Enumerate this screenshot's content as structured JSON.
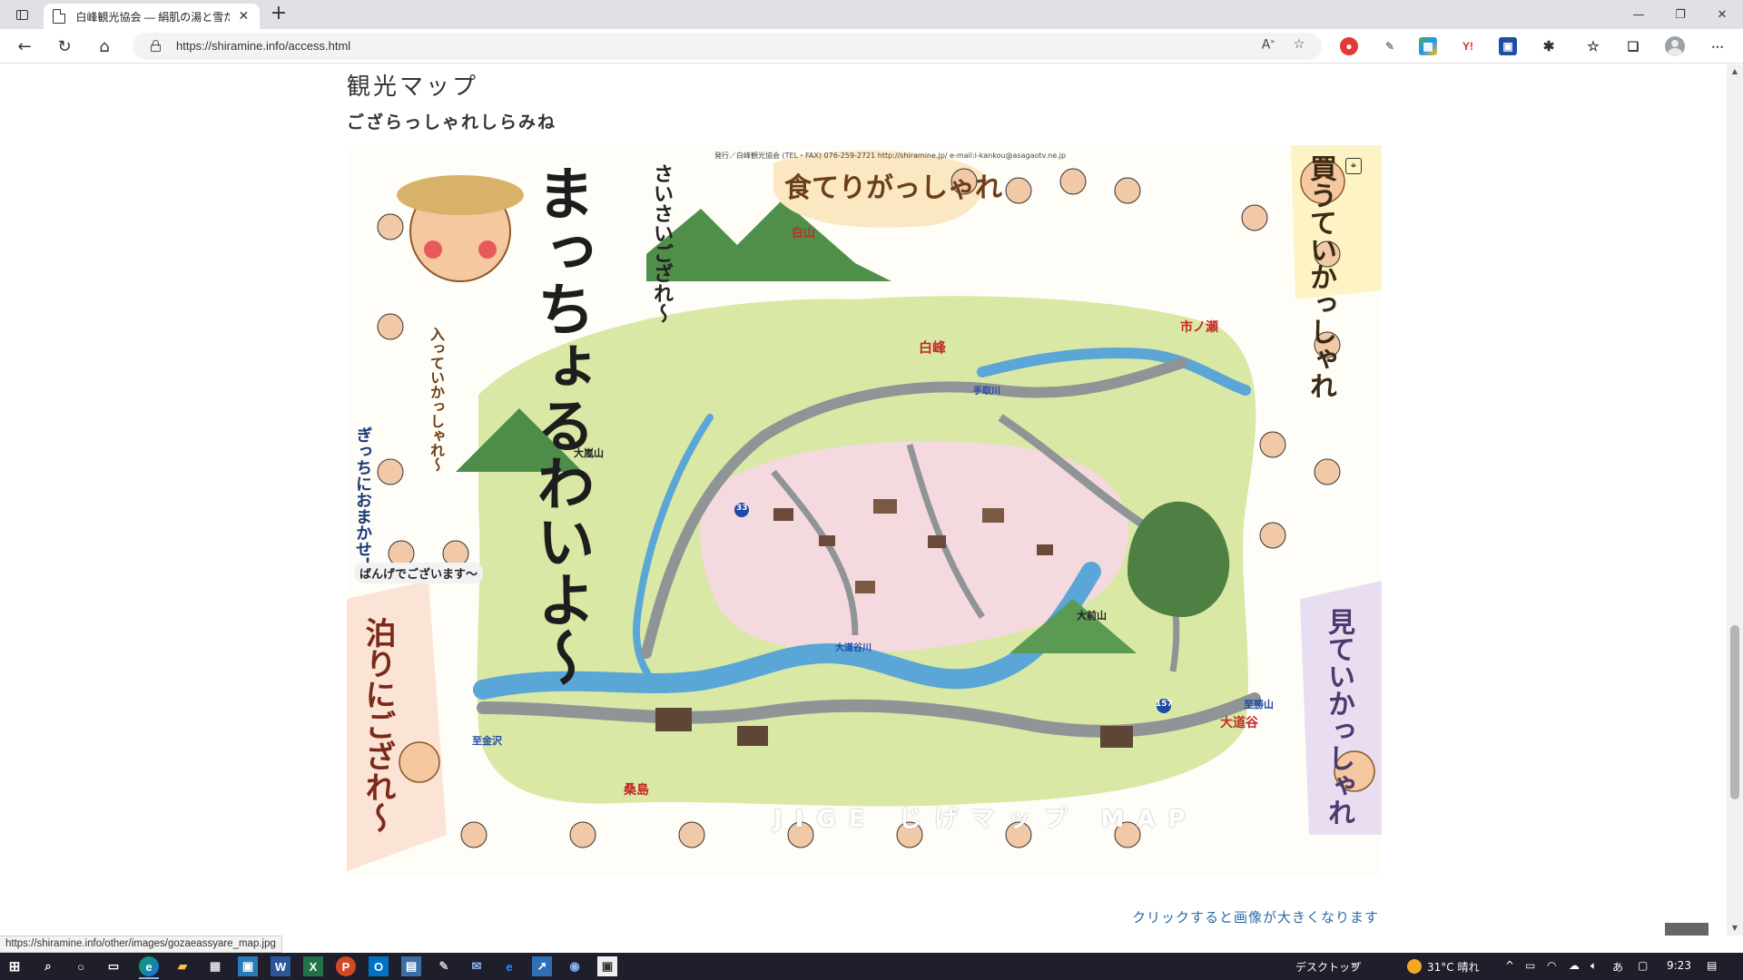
{
  "browser": {
    "tab_title": "白峰観光協会 — 絹肌の湯と雪だるまの里",
    "tab_close": "✕",
    "new_tab": "+",
    "url": "https://shiramine.info/access.html",
    "window": {
      "minimize": "—",
      "restore": "❐",
      "close": "✕"
    },
    "nav": {
      "back": "←",
      "reload": "↻",
      "home": "⌂"
    }
  },
  "page": {
    "title": "観光マップ",
    "subtitle": "ござらっしゃれしらみね",
    "image_caption_link": "クリックすると画像が大きくなります",
    "scroll_top": "↑"
  },
  "map": {
    "header_line": "発行／白峰観光協会 (TEL・FAX) 076-259-2721 http://shiramine.jp/ e-mail:i-kankou@asagaotv.ne.jp",
    "slogans": {
      "main": "まっちょるわいよ〜",
      "eat": "食てりがっしゃれ",
      "buy": "買うていかっしゃれ",
      "see": "見ていかっしゃれ",
      "stay": "泊りにござれ〜",
      "welcome": "さいさいござれ〜",
      "bath": "入っていかっしゃれ〜",
      "guide": "ぎっちにおまかせ！",
      "banner": "ばんげでございます〜",
      "bottom_title": "JIGE じげマップ MAP"
    },
    "places": {
      "hakusan": "白山",
      "shiramine": "白峰",
      "ichinose": "市ノ瀬",
      "oomichidani": "大道谷",
      "kuwajima": "桑島",
      "oarashiyama": "大嵐山",
      "ookanayama": "大前山",
      "shishiumi": "至金沢",
      "shishiganami": "至勝山",
      "tedorigawa": "手取川",
      "daidoyagawa": "大道谷川",
      "route33": "33",
      "route157": "157"
    }
  },
  "statusbar": {
    "hover_url": "https://shiramine.info/other/images/gozaeassyare_map.jpg"
  },
  "taskbar": {
    "desktop_label": "デスクトップ",
    "weather": "31°C 晴れ",
    "ime": "あ",
    "time": "9:23"
  },
  "colors": {
    "link": "#2a6aa5",
    "scroll_top_bg": "#666666",
    "map_green": "#d9e8a4",
    "map_road": "#8f9496",
    "map_river": "#5aa6d6",
    "map_pink": "#f6d7e6"
  }
}
